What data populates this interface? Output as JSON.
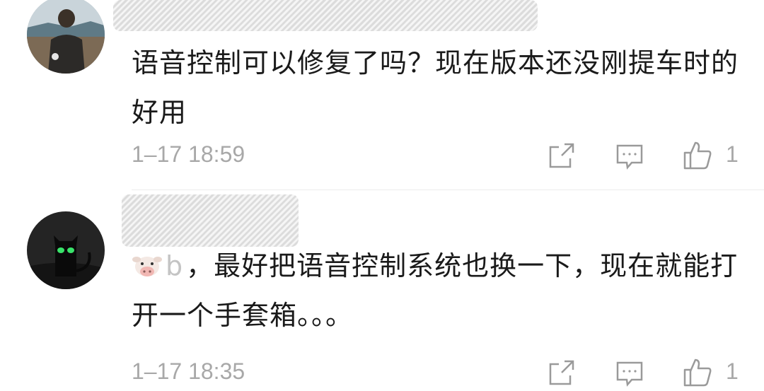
{
  "comments": [
    {
      "text": "语音控制可以修复了吗？现在版本还没刚提车时的好用",
      "time": "1–17 18:59",
      "likes": "1"
    },
    {
      "reply_prefix": "，",
      "text": "最好把语音控制系统也换一下，现在就能打开一个手套箱。。。",
      "time": "1–17 18:35",
      "likes": "1"
    }
  ],
  "icons": {
    "share": "share-icon",
    "reply": "comment-icon",
    "like": "thumbs-up-icon",
    "emoji": "cow-emoji"
  },
  "colors": {
    "text": "#1a1a1a",
    "meta": "#a8a8a8",
    "divider": "#ececec"
  }
}
